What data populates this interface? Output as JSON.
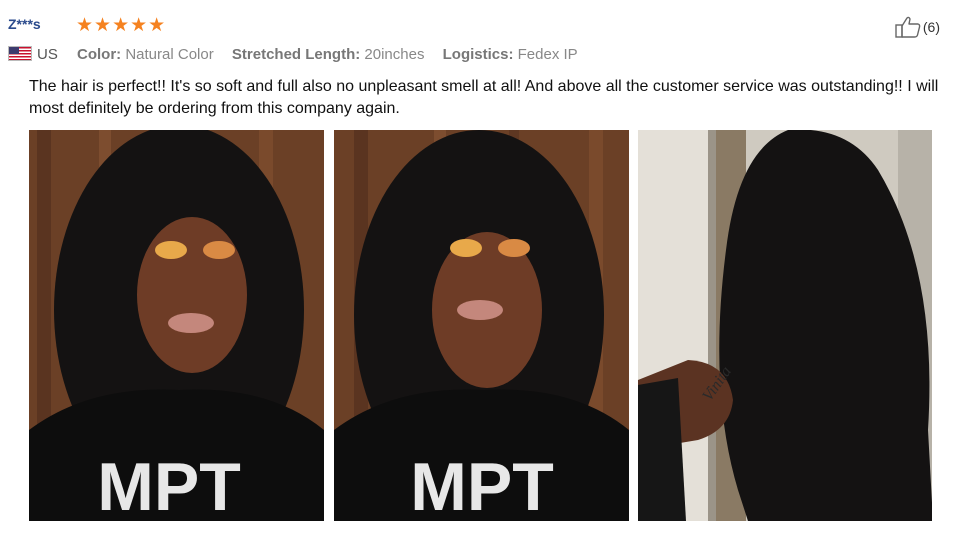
{
  "review": {
    "username": "Z***s",
    "rating_stars": 5,
    "stars_text": "★★★★★",
    "country": "US",
    "attributes": [
      {
        "key": "Color:",
        "value": "Natural Color"
      },
      {
        "key": "Stretched Length:",
        "value": "20inches"
      },
      {
        "key": "Logistics:",
        "value": "Fedex IP"
      }
    ],
    "helpful_count": "(6)",
    "text": "The hair is perfect!! It's so soft and full also no unpleasant smell at all! And above all the customer service was outstanding!! I will most definitely be ordering from this company again.",
    "photos": [
      {
        "shirt_text": "MPT"
      },
      {
        "shirt_text": "MPT"
      },
      {
        "tattoo_text": "Vinita"
      }
    ]
  },
  "colors": {
    "username": "#2a4a8c",
    "stars": "#f58220",
    "attribute_text": "#888888",
    "wood": "#7a4a2c",
    "hair": "#141212",
    "skin": "#6e3c26"
  },
  "icons": [
    "us-flag-icon",
    "star-icon",
    "thumbs-up-icon"
  ]
}
